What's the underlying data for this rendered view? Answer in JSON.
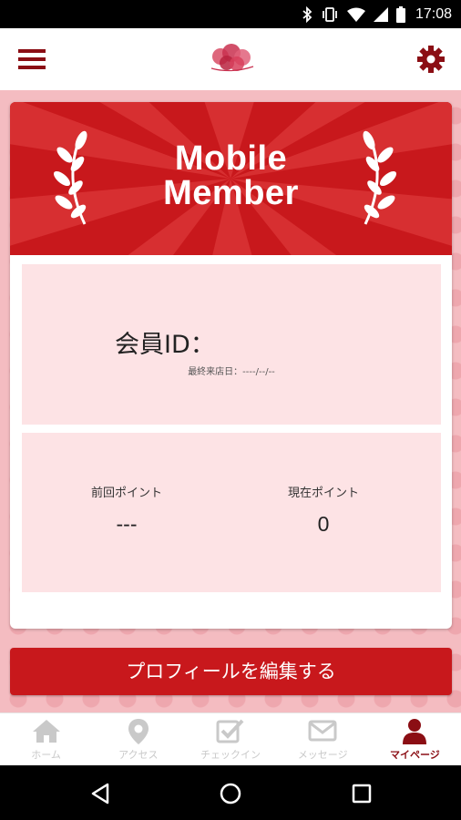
{
  "status_bar": {
    "time": "17:08",
    "icons": [
      "bluetooth-icon",
      "vibrate-icon",
      "wifi-icon",
      "signal-icon",
      "battery-icon"
    ]
  },
  "app_bar": {
    "menu_icon": "hamburger-menu-icon",
    "logo_icon": "shop-logo-icon",
    "settings_icon": "gear-icon"
  },
  "colors": {
    "brand_red": "#c8181c",
    "dark_red": "#8b0e14",
    "panel_pink": "#fde3e5",
    "background_pink": "#f4bcc1"
  },
  "banner": {
    "title_line1": "Mobile",
    "title_line2": "Member"
  },
  "member": {
    "id_label": "会員ID：",
    "last_visit": "最終来店日：----/--/--"
  },
  "points": {
    "previous": {
      "label": "前回ポイント",
      "value": "---"
    },
    "current": {
      "label": "現在ポイント",
      "value": "0"
    }
  },
  "edit_profile_button": "プロフィールを編集する",
  "tabs": [
    {
      "label": "ホーム",
      "icon": "home-icon",
      "active": false
    },
    {
      "label": "アクセス",
      "icon": "map-pin-icon",
      "active": false
    },
    {
      "label": "チェックイン",
      "icon": "checkin-icon",
      "active": false
    },
    {
      "label": "メッセージ",
      "icon": "envelope-icon",
      "active": false
    },
    {
      "label": "マイページ",
      "icon": "user-icon",
      "active": true
    }
  ],
  "nav_bar": {
    "buttons": [
      "back-icon",
      "home-circle-icon",
      "recents-icon"
    ]
  }
}
